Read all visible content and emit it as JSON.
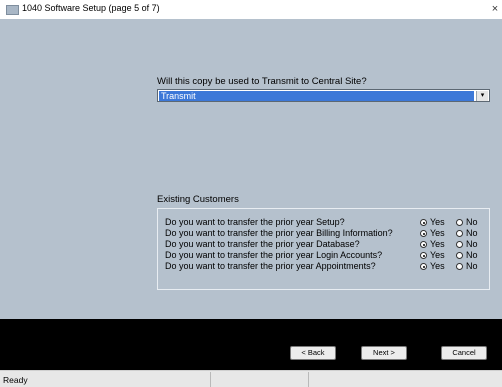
{
  "window": {
    "title": "1040 Software Setup (page 5 of 7)",
    "close_glyph": "×",
    "app_icon": "window-icon"
  },
  "transmit": {
    "question": "Will this copy be used to Transmit to Central Site?",
    "selected": "Transmit",
    "arrow_glyph": "▾"
  },
  "existing": {
    "title": "Existing Customers",
    "yes_label": "Yes",
    "no_label": "No",
    "rows": [
      {
        "label": "Do you want to transfer the prior year Setup?",
        "value": "Yes"
      },
      {
        "label": "Do you want to transfer the prior year Billing Information?",
        "value": "Yes"
      },
      {
        "label": "Do you want to transfer the prior year Database?",
        "value": "Yes"
      },
      {
        "label": "Do you want to transfer the prior year Login Accounts?",
        "value": "Yes"
      },
      {
        "label": "Do you want to transfer the prior year Appointments?",
        "value": "Yes"
      }
    ]
  },
  "buttons": {
    "back": "< Back",
    "next": "Next >",
    "cancel": "Cancel"
  },
  "status": {
    "text": "Ready"
  },
  "colors": {
    "panel": "#b5c1cd",
    "selection": "#3c78d8",
    "footer": "#000000"
  }
}
